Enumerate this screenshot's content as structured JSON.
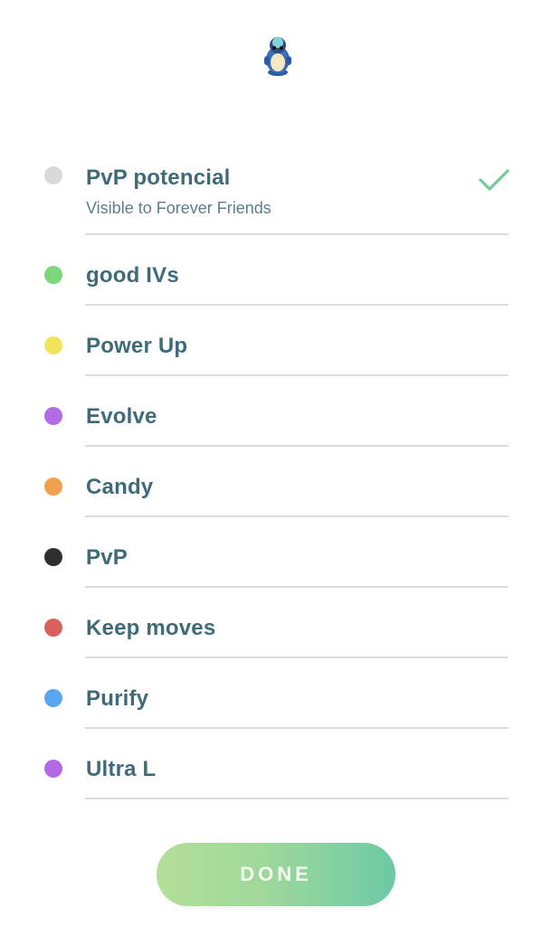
{
  "header": {
    "sprite_icon": "pokemon-sprite-icon"
  },
  "tags": [
    {
      "label": "PvP potencial",
      "sublabel": "Visible to Forever Friends",
      "color": "#d9d9d9",
      "selected": true
    },
    {
      "label": "good IVs",
      "color": "#7ad77a",
      "selected": false
    },
    {
      "label": "Power Up",
      "color": "#f2e55e",
      "selected": false
    },
    {
      "label": "Evolve",
      "color": "#b46ae6",
      "selected": false
    },
    {
      "label": "Candy",
      "color": "#f0a14b",
      "selected": false
    },
    {
      "label": "PvP",
      "color": "#2f2f2f",
      "selected": false
    },
    {
      "label": "Keep moves",
      "color": "#d9615c",
      "selected": false
    },
    {
      "label": "Purify",
      "color": "#5aa6ef",
      "selected": false
    },
    {
      "label": "Ultra L",
      "color": "#b46ae6",
      "selected": false
    }
  ],
  "check_icon": "checkmark-icon",
  "check_color": "#73c99a",
  "done_button": {
    "label": "DONE"
  }
}
